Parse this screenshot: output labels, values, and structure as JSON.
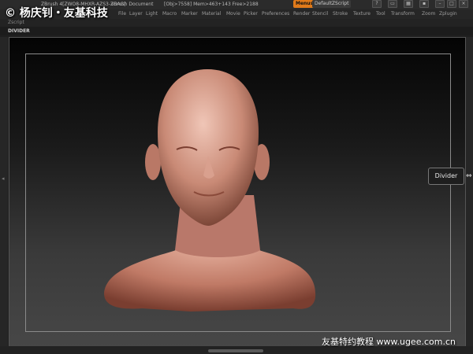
{
  "titlebar": {
    "app": "ZBrush 4[ZWO8-MHXR-AZS3-3GAG]",
    "document": "ZBrush Document",
    "obj": "[Obj>7558] Mem>463+143 Free>2188",
    "menus": "Menus",
    "script": "DefaultZScript"
  },
  "menubar": {
    "items": [
      "File",
      "Layer",
      "Light",
      "Macro",
      "Marker",
      "Material",
      "Movie",
      "Picker",
      "Preferences",
      "Render",
      "Stencil",
      "Stroke",
      "Texture",
      "Tool",
      "Transform",
      "Zoom",
      "Zplugin"
    ]
  },
  "subbar": {
    "label": "Zscript"
  },
  "tabbar": {
    "label": "DIVIDER"
  },
  "tooltip": {
    "text": "Divider"
  },
  "watermark": {
    "top_left": "© 杨庆钊・友基科技",
    "bottom_right": "友基特约教程 www.ugee.com.cn"
  },
  "colors": {
    "accent": "#e07a1a",
    "skin": "#c98a76"
  }
}
